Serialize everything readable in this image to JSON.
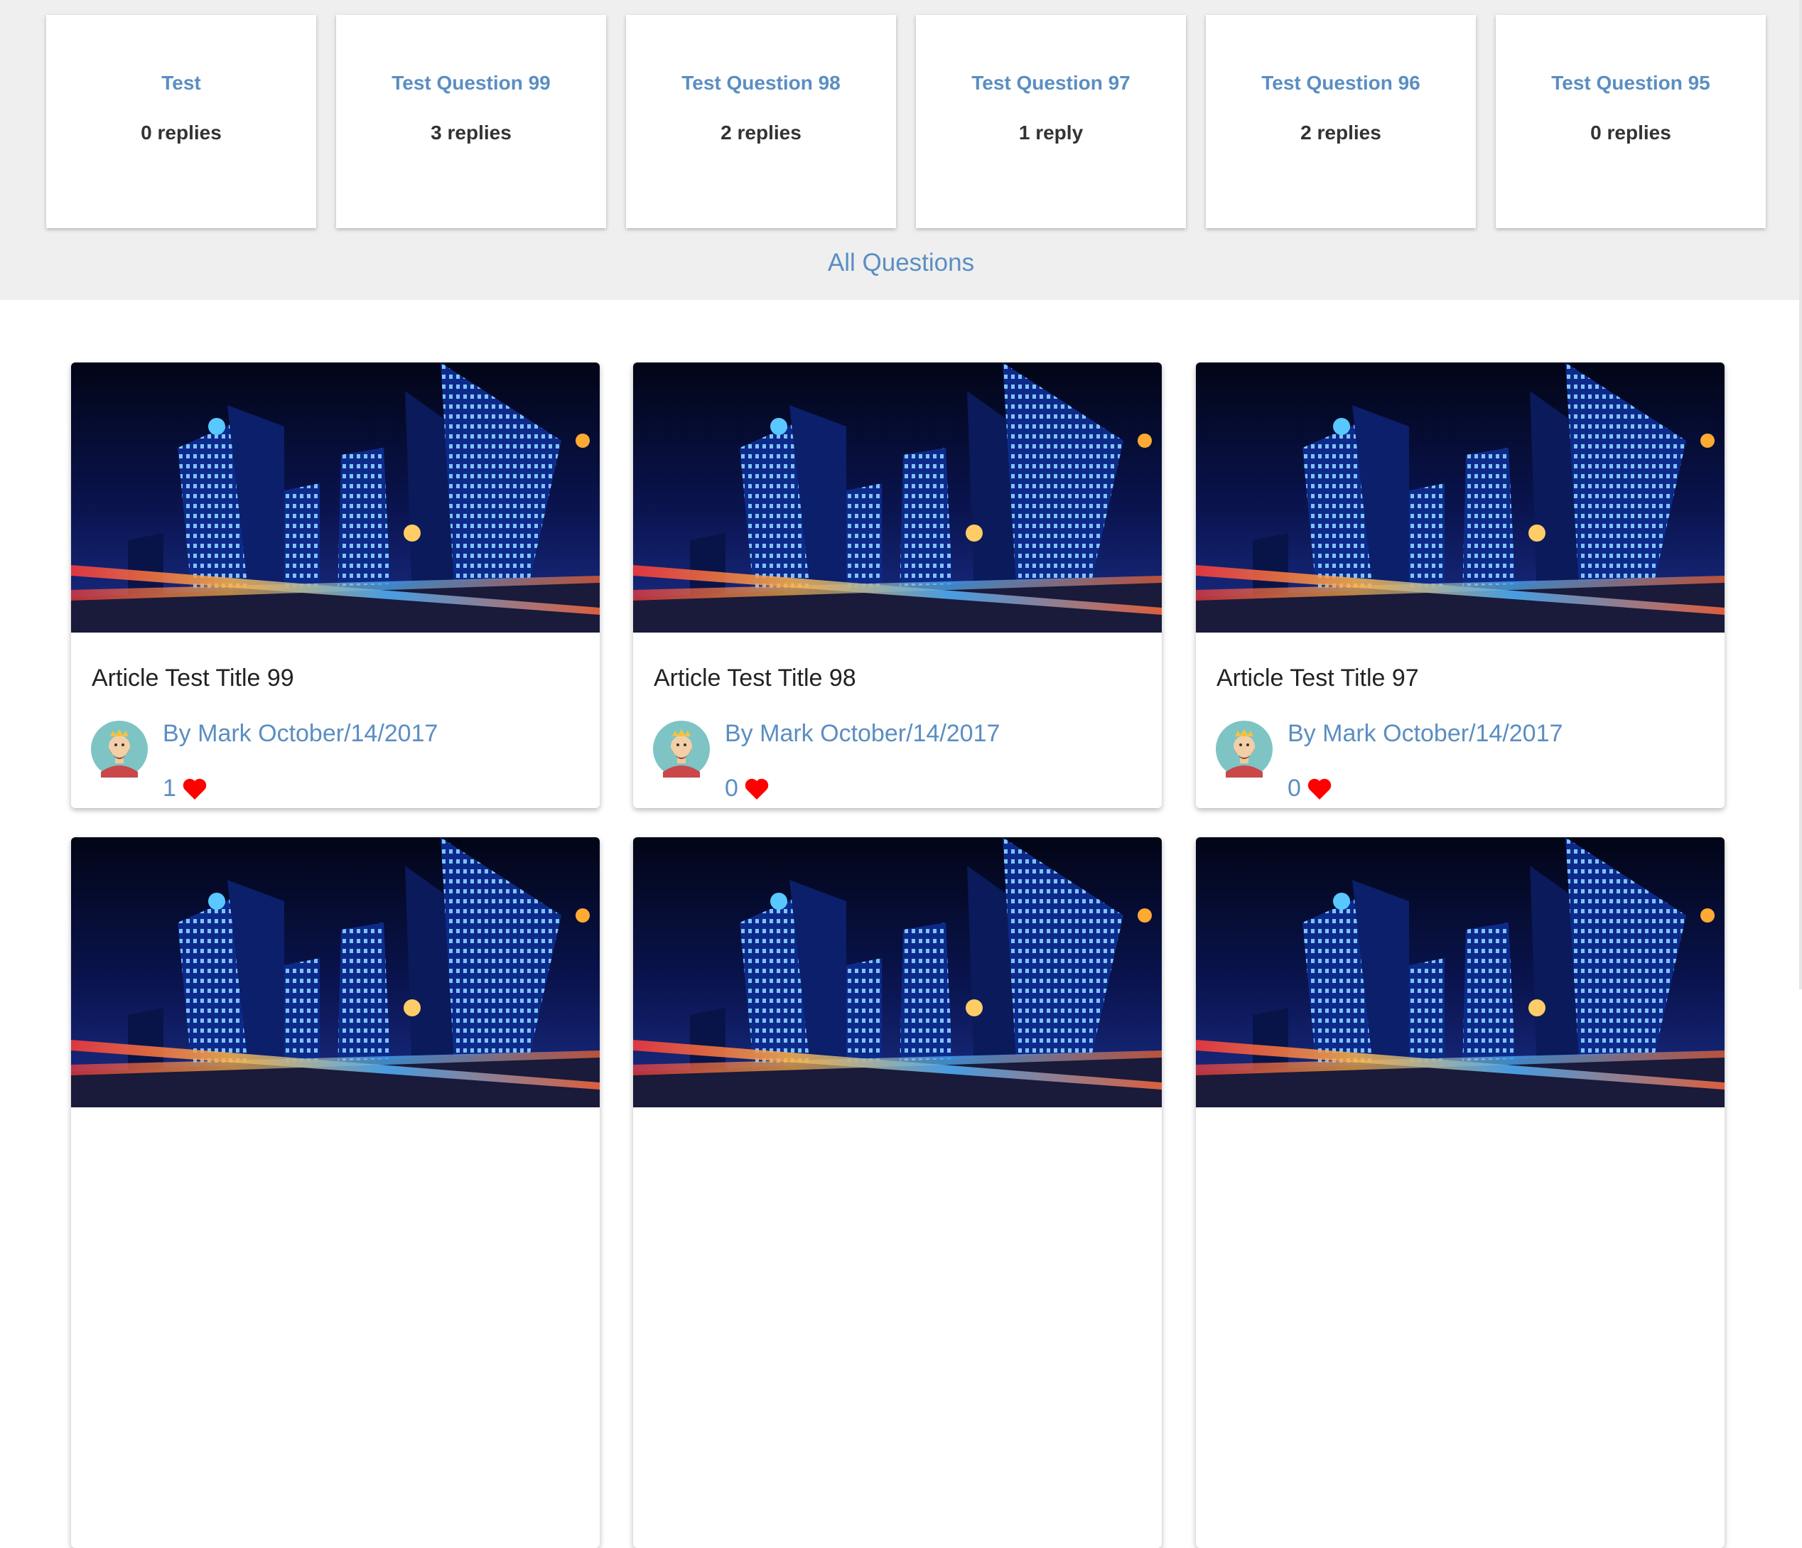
{
  "questions": [
    {
      "title": "Test",
      "replies": "0 replies"
    },
    {
      "title": "Test Question 99",
      "replies": "3 replies"
    },
    {
      "title": "Test Question 98",
      "replies": "2 replies"
    },
    {
      "title": "Test Question 97",
      "replies": "1 reply"
    },
    {
      "title": "Test Question 96",
      "replies": "2 replies"
    },
    {
      "title": "Test Question 95",
      "replies": "0 replies"
    }
  ],
  "all_questions_label": "All Questions",
  "articles": [
    {
      "title": "Article Test Title 99",
      "byline": "By Mark October/14/2017",
      "likes": "1"
    },
    {
      "title": "Article Test Title 98",
      "byline": "By Mark October/14/2017",
      "likes": "0"
    },
    {
      "title": "Article Test Title 97",
      "byline": "By Mark October/14/2017",
      "likes": "0"
    }
  ],
  "icons": {
    "like": "heart-icon",
    "avatar": "avatar-icon"
  },
  "colors": {
    "link": "#5b8ec2",
    "heart": "#ff0000",
    "band": "#efefef"
  }
}
